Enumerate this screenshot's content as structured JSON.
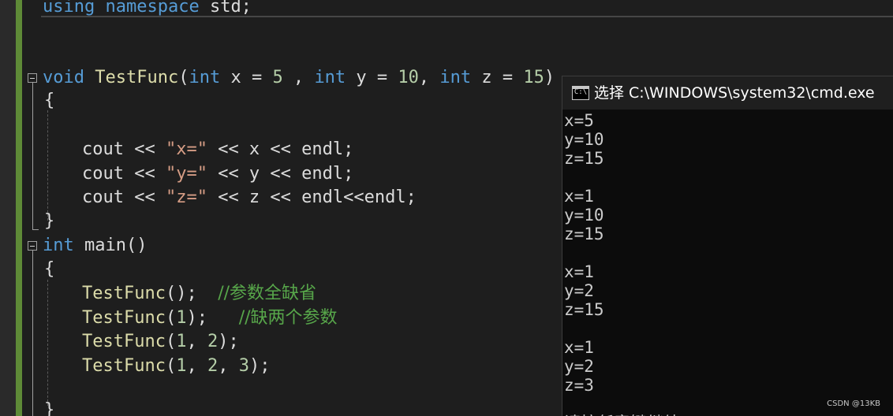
{
  "editor": {
    "lines": {
      "using": {
        "kw1": "using",
        "kw2": "namespace",
        "rest": " std;"
      },
      "testfunc_decl": {
        "kw_void": "void",
        "fn_name": "TestFunc",
        "p_open": "(",
        "kw_int1": "int",
        "p1": " x = ",
        "v1": "5",
        "sep1": " , ",
        "kw_int2": "int",
        "p2": " y = ",
        "v2": "10",
        "sep2": ", ",
        "kw_int3": "int",
        "p3": " z = ",
        "v3": "15",
        "p_close": ")"
      },
      "brace_open_1": "{",
      "cout_x": {
        "a": "cout << ",
        "s": "\"x=\"",
        "b": " << x << endl;"
      },
      "cout_y": {
        "a": "cout << ",
        "s": "\"y=\"",
        "b": " << y << endl;"
      },
      "cout_z": {
        "a": "cout << ",
        "s": "\"z=\"",
        "b": " << z << endl<<endl;"
      },
      "brace_close_1": "}",
      "main_decl": {
        "kw_int": "int",
        "rest": " main()"
      },
      "brace_open_2": "{",
      "call1": {
        "fn": "TestFunc",
        "args": "();  ",
        "cmt": "//参数全缺省"
      },
      "call2": {
        "fn": "TestFunc",
        "a": "(",
        "n": "1",
        "b": ");   ",
        "cmt": "//缺两个参数"
      },
      "call3": {
        "fn": "TestFunc",
        "a": "(",
        "n1": "1",
        "s1": ", ",
        "n2": "2",
        "b": ");"
      },
      "call4": {
        "fn": "TestFunc",
        "a": "(",
        "n1": "1",
        "s1": ", ",
        "n2": "2",
        "s2": ", ",
        "n3": "3",
        "b": ");"
      },
      "brace_close_2": "}"
    }
  },
  "console": {
    "icon_text": "C:\\",
    "title": "选择 C:\\WINDOWS\\system32\\cmd.exe",
    "output": [
      "x=5",
      "y=10",
      "z=15",
      "",
      "x=1",
      "y=10",
      "z=15",
      "",
      "x=1",
      "y=2",
      "z=15",
      "",
      "x=1",
      "y=2",
      "z=3",
      ""
    ],
    "cut_line": "请按任意键继续"
  },
  "watermark": "CSDN @13KB",
  "colors": {
    "background": "#1e1e1e",
    "keyword": "#569cd6",
    "function": "#dcdcaa",
    "string": "#d69d85",
    "number": "#b5cea8",
    "comment": "#57a64a",
    "change_bar": "#5e8a37"
  }
}
